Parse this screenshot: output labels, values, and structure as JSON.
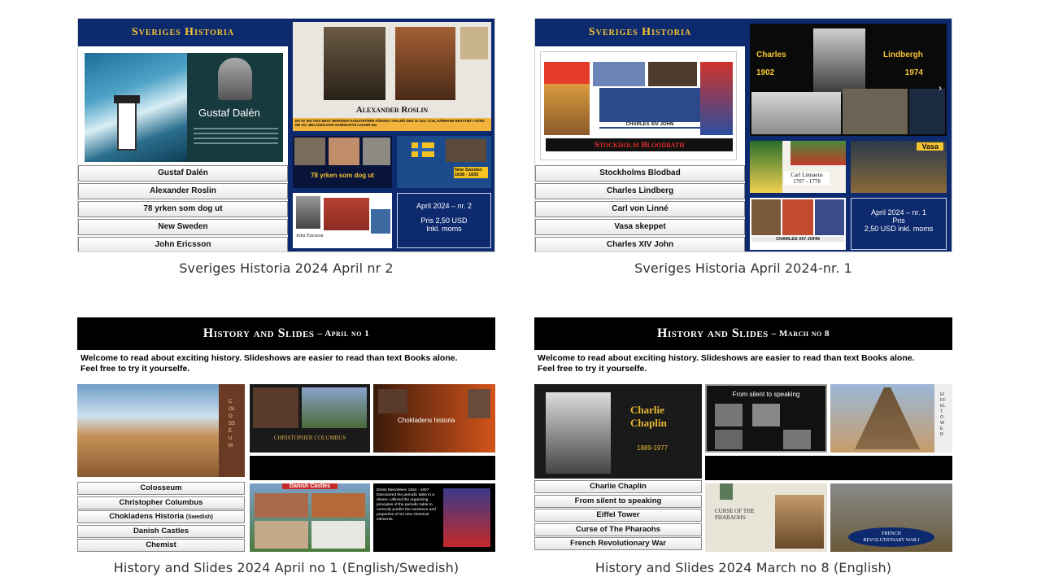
{
  "cards": [
    {
      "caption": "Sveriges Historia 2024 April nr 2",
      "header": "Sveriges Historia",
      "list": [
        "Gustaf Dalén",
        "Alexander Roslin",
        "78 yrken som dog ut",
        "New Sweden",
        "John Ericsson"
      ],
      "feature_name": "Gustaf Dalén",
      "slide_title": "Alexander Roslin",
      "banner_text": "EN AV SIN TIDS MEST BERÖMDA KONSTNÄRER FÖDDES I MALMÖ DEN 15 JULI 1718, NÄRMARE BESTÄMT I GÅRD NR 337, BELÄGEN DÄR HAMNGATAN LIGGER NU.",
      "yrken": "78 yrken som dog ut",
      "new_sweden": "New Sweden\n1638 - 1655",
      "john": "John Ericsson",
      "price": [
        "April 2024 – nr. 2",
        "Pris 2,50 USD",
        "Inkl. moms"
      ]
    },
    {
      "caption": "Sveriges Historia April 2024-nr. 1",
      "header": "Sveriges Historia",
      "list": [
        "Stockholms Blodbad",
        "Charles Lindberg",
        "Carl von Linné",
        "Vasa skeppet",
        "Charles XIV John"
      ],
      "blodbad": "Stockholm Bloodbath",
      "charles_xiv": "CHARLES XIV JOHN",
      "lind_left": "Charles\n1902",
      "lind_right": "Lindbergh\n1974",
      "linnaeus": "Carl Linnaeus\n1707 - 1778",
      "vasa": "Vasa",
      "price": [
        "April 2024 – nr. 1",
        "Pris",
        "2,50 USD inkl. moms"
      ]
    },
    {
      "caption": "History and Slides 2024 April no 1 (English/Swedish)",
      "header_main": "History and Slides",
      "header_sub": "– April no 1",
      "intro": "Welcome to read about exciting history. Slideshows are easier to read than text Books alone.\nFeel free to try it yourselfe.",
      "list": [
        "Colosseum",
        "Christopher Columbus",
        "Chokladens Historia",
        "Danish Castles",
        "Chemist"
      ],
      "list_small": "(Swedish)",
      "colosseum_v": "COLOSSEUM",
      "columbus": "CHRISTOPHER COLUMBUS",
      "choklad": "Chokladens historia",
      "danish": "Danish Castles",
      "chemist_text": "Dmitri Mendeleev 1834 - 1907\nDiscovered the periodic table in a dream. Utilized the organizing principles of the periodic table to correctly predict the existence and properties of six new chemical elements."
    },
    {
      "caption": "History and Slides 2024 March no 8 (English)",
      "header_main": "History and Slides",
      "header_sub": "– March no 8",
      "intro": "Welcome to read about exciting history. Slideshows are easier to read than text Books alone.\nFeel free to try it yourselfe.",
      "list": [
        "Charlie Chaplin",
        "From silent to speaking",
        "Eiffel Tower",
        "Curse of The Pharaohs",
        "French Revolutionary War"
      ],
      "chaplin": "Charlie\nChaplin",
      "chaplin_years": "1889-1977",
      "silent": "From silent to speaking",
      "eiffel_v": "EIFFEL TOWER",
      "curse": "CURSE OF THE\nPHARAOHS",
      "french": "FRENCH\nREVOLUTIONARY WAR I"
    }
  ]
}
